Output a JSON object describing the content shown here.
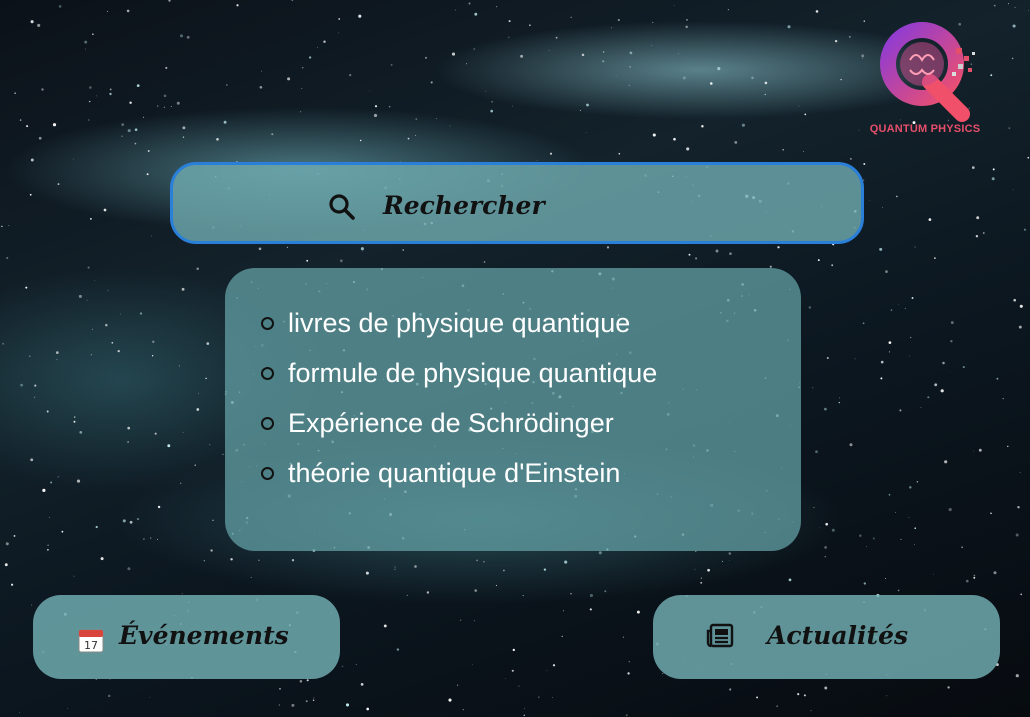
{
  "brand": {
    "name": "QUANTUM PHYSICS",
    "accent": "#e64f6a",
    "logo_letter": "Q"
  },
  "search": {
    "label": "Rechercher",
    "icon": "search-icon",
    "border_color": "#2a7fd8"
  },
  "suggestions": [
    {
      "label": "livres de physique quantique"
    },
    {
      "label": "formule de physique quantique"
    },
    {
      "label": "Expérience de Schrödinger"
    },
    {
      "label": "théorie quantique d'Einstein"
    }
  ],
  "nav": {
    "events": {
      "label": "Événements",
      "icon": "calendar-icon",
      "icon_day": "17"
    },
    "news": {
      "label": "Actualités",
      "icon": "newspaper-icon"
    }
  }
}
